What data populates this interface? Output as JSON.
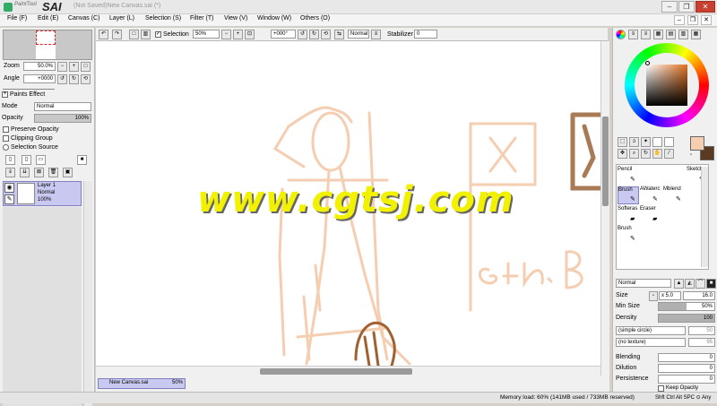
{
  "app": {
    "logo_small": "PaintTool",
    "logo_big": "SAI",
    "document_title": "(Not Saved)New Canvas.sai (*)"
  },
  "window_controls": {
    "minimize": "–",
    "restore": "❐",
    "close": "✕"
  },
  "menu": [
    "File (F)",
    "Edit (E)",
    "Canvas (C)",
    "Layer (L)",
    "Selection (S)",
    "Filter (T)",
    "View (V)",
    "Window (W)",
    "Others (O)"
  ],
  "navigator": {
    "zoom_label": "Zoom",
    "zoom_value": "50.0%",
    "angle_label": "Angle",
    "angle_value": "+0000"
  },
  "layer_panel": {
    "paints_effect": "Paints Effect",
    "mode_label": "Mode",
    "mode_value": "Normal",
    "opacity_label": "Opacity",
    "opacity_value": "100%",
    "preserve_opacity": "Preserve Opacity",
    "clipping_group": "Clipping Group",
    "selection_source": "Selection Source",
    "layer": {
      "name": "Layer 1",
      "mode": "Normal",
      "opacity": "100%"
    }
  },
  "canvas_toolbar": {
    "selection_label": "Selection",
    "zoom_value": "50%",
    "angle_value": "+000°",
    "blend_value": "Normal",
    "stabilizer_label": "Stabilizer",
    "stabilizer_value": "0"
  },
  "tools": {
    "row1": [
      "Pencil",
      "",
      "",
      "Sketch"
    ],
    "row2": [
      "Brush",
      "AWaterc",
      "Mblend",
      ""
    ],
    "row3": [
      "Softeras",
      "Eraser",
      "",
      ""
    ],
    "row4": [
      "Brush",
      "",
      "",
      ""
    ]
  },
  "brush_settings": {
    "mode_value": "Normal",
    "size_label": "Size",
    "size_mult": "x 5.0",
    "size_value": "16.0",
    "min_size_label": "Min Size",
    "min_size_value": "50%",
    "density_label": "Density",
    "density_value": "100",
    "shape_value": "(simple circle)",
    "shape_num": "50",
    "texture_value": "(no texture)",
    "texture_num": "95",
    "blending_label": "Blending",
    "blending_value": "0",
    "dilution_label": "Dilution",
    "dilution_value": "0",
    "persistence_label": "Persistence",
    "persistence_value": "0",
    "keep_opacity": "Keep Opacity"
  },
  "tab": {
    "name": "New Canvas.sai",
    "zoom": "50%"
  },
  "status": {
    "memory": "Memory load: 60% (141MB used / 733MB reserved)",
    "keys": "Shft Ctrl Alt SPC ⊙ Any"
  },
  "colors": {
    "primary": "#f5cdb0",
    "secondary": "#5a3a20",
    "accent_blue": "#c8c8f0"
  },
  "watermark": "www.cgtsj.com"
}
